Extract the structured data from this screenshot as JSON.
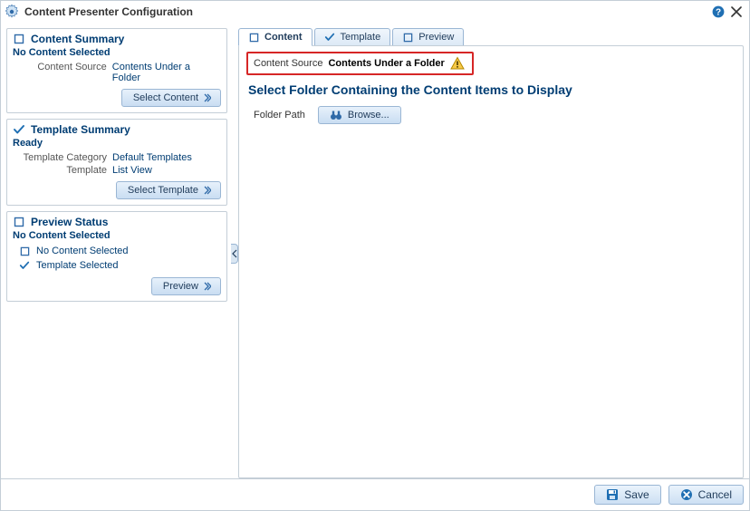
{
  "dialog": {
    "title": "Content Presenter Configuration"
  },
  "sidebar": {
    "content_summary": {
      "title": "Content Summary",
      "status": "No Content Selected",
      "rows": [
        {
          "label": "Content Source",
          "value": "Contents Under a Folder"
        }
      ],
      "action": "Select Content"
    },
    "template_summary": {
      "title": "Template Summary",
      "status": "Ready",
      "rows": [
        {
          "label": "Template Category",
          "value": "Default Templates"
        },
        {
          "label": "Template",
          "value": "List View"
        }
      ],
      "action": "Select Template"
    },
    "preview_status": {
      "title": "Preview Status",
      "status": "No Content Selected",
      "items": [
        {
          "icon": "square",
          "text": "No Content Selected"
        },
        {
          "icon": "check",
          "text": "Template Selected"
        }
      ],
      "action": "Preview"
    }
  },
  "tabs": [
    {
      "id": "content",
      "label": "Content",
      "icon": "square",
      "active": true
    },
    {
      "id": "template",
      "label": "Template",
      "icon": "check",
      "active": false
    },
    {
      "id": "preview",
      "label": "Preview",
      "icon": "square",
      "active": false
    }
  ],
  "main": {
    "content_source": {
      "label": "Content Source",
      "value": "Contents Under a Folder"
    },
    "section_title": "Select Folder Containing the Content Items to Display",
    "folder_path": {
      "label": "Folder Path",
      "browse": "Browse..."
    }
  },
  "footer": {
    "save": "Save",
    "cancel": "Cancel"
  }
}
